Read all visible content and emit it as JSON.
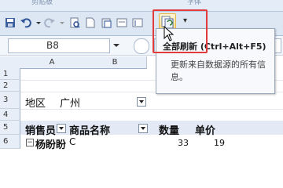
{
  "ribbon": {
    "group_left": "剪贴板",
    "group_right": "字体"
  },
  "qat": {
    "customize_arrow": "▾"
  },
  "namebox": {
    "value": "B8"
  },
  "grid": {
    "col_headers": [
      "A",
      "B"
    ],
    "row_headers": [
      "1",
      "2",
      "3",
      "4",
      "5",
      "6"
    ],
    "filter": {
      "label": "地区",
      "value": "广州"
    },
    "pivot_headers": [
      "销售员",
      "商品名称",
      "数量",
      "单价"
    ],
    "row6": {
      "salesperson": "杨盼盼",
      "product": "C",
      "quantity": "33",
      "price": "19"
    }
  },
  "tooltip": {
    "title": "全部刷新 (Ctrl+Alt+F5)",
    "description": "更新来自数据源的所有信息。"
  },
  "colors": {
    "highlight": "#e23b3b",
    "ribbon_bg": "#dde7f4"
  }
}
